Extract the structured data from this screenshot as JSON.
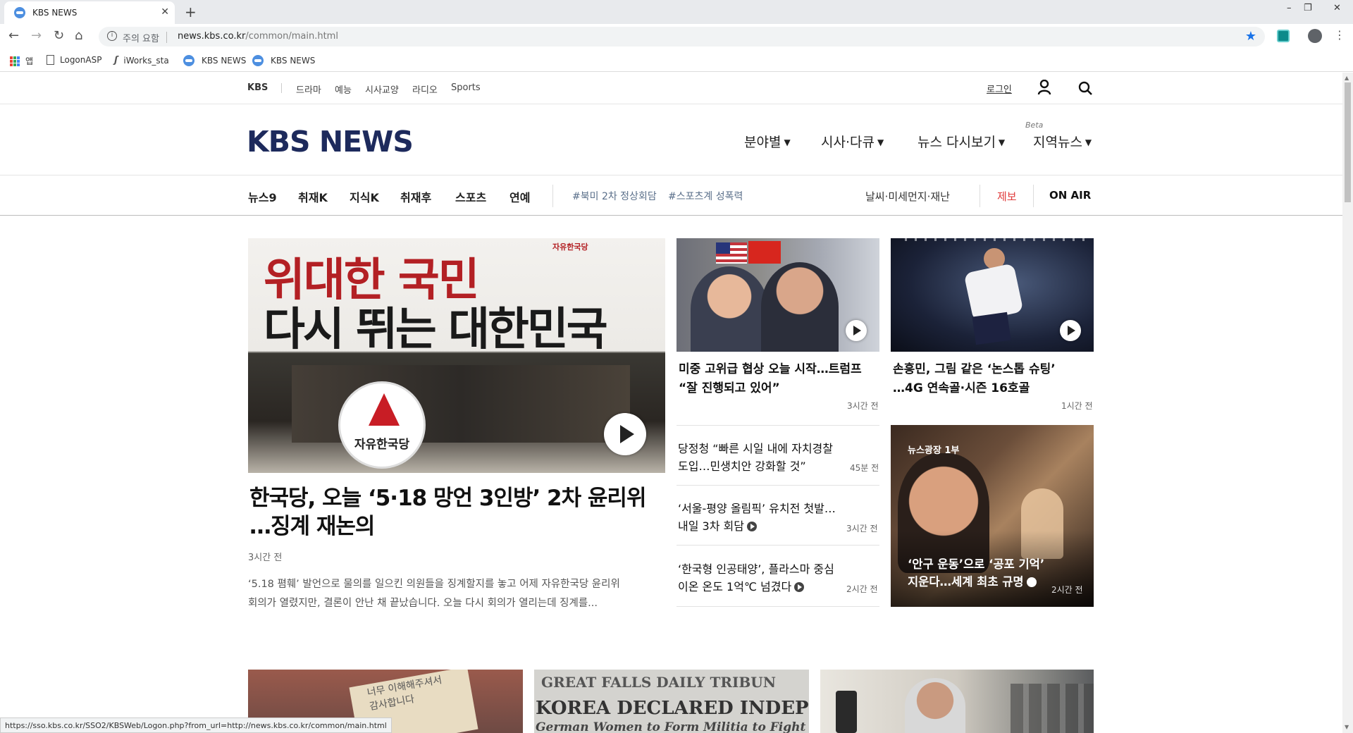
{
  "browser": {
    "tab_title": "KBS NEWS",
    "new_tab": "+",
    "window_controls": [
      "–",
      "❐",
      "✕"
    ],
    "omnibox_warning": "주의 요함",
    "url_host": "news.kbs.co.kr",
    "url_path": "/common/main.html",
    "bookmarks": [
      "앱",
      "LogonASP",
      "iWorks_sta",
      "KBS NEWS",
      "KBS NEWS"
    ],
    "status_url": "https://sso.kbs.co.kr/SSO2/KBSWeb/Logon.php?from_url=http://news.kbs.co.kr/common/main.html"
  },
  "gnb": {
    "brand": "KBS",
    "items": [
      "드라마",
      "예능",
      "시사교양",
      "라디오",
      "Sports"
    ],
    "login": "로그인"
  },
  "header": {
    "logo": "KBS NEWS",
    "menus": [
      "분야별",
      "시사·다큐",
      "뉴스 다시보기",
      "지역뉴스"
    ],
    "beta": "Beta"
  },
  "subnav": {
    "items": [
      "뉴스9",
      "취재K",
      "지식K",
      "취재후",
      "스포츠",
      "연예"
    ],
    "tags": [
      "#북미 2차 정상회담",
      "#스포츠계 성폭력"
    ],
    "right": [
      "날씨·미세먼지·재난",
      "제보",
      "ON AIR"
    ]
  },
  "main_story": {
    "image_text_line1": "위대한 국민",
    "image_text_line2": "다시 뛰는 대한민국",
    "image_party": "자유한국당",
    "image_corner": "자유한국당",
    "headline_line1": "한국당, 오늘 ‘5·18 망언 3인방’ 2차 윤리위",
    "headline_line2": "…징계 재논의",
    "time": "3시간 전",
    "summary_line1": "‘5.18 폄훼’ 발언으로 물의를 일으킨 의원들을 징계할지를 놓고 어제 자유한국당 윤리위",
    "summary_line2": "회의가 열렸지만, 결론이 안난 채 끝났습니다. 오늘 다시 회의가 열리는데 징계를..."
  },
  "story_trump": {
    "headline_line1": "미중 고위급 협상 오늘 시작…트럼프",
    "headline_line2": "“잘 진행되고 있어”",
    "time": "3시간 전"
  },
  "story_son": {
    "headline_line1": "손흥민, 그림 같은 ‘논스톱 슈팅’",
    "headline_line2": "…4G 연속골·시즌 16호골",
    "time": "1시간 전"
  },
  "list_stories": [
    {
      "line1": "당정청 “빠른 시일 내에 자치경찰",
      "line2": "도입…민생치안 강화할 것”",
      "time": "45분 전"
    },
    {
      "line1": "‘서울-평양 올림픽’ 유치전 첫발…",
      "line2": "내일 3차 회담",
      "time": "3시간 전"
    },
    {
      "line1": "‘한국형 인공태양’, 플라스마 중심",
      "line2": "이온 온도 1억℃ 넘겼다",
      "time": "2시간 전"
    }
  ],
  "feature_story": {
    "badge": "뉴스광장 1부",
    "line1": "‘안구 운동’으로 ‘공포 기억’",
    "line2": "지운다…세계 최초 규명",
    "time": "2시간 전"
  },
  "bottom_images": {
    "note_text_line1": "너무 이해해주셔서",
    "note_text_line2": "감사합니다",
    "paper_line1": "GREAT FALLS DAILY TRIBUN",
    "paper_line2": "KOREA DECLARED INDEPENDE",
    "paper_line3": "German Women to Form Militia to Fight I"
  },
  "colors": {
    "logo": "#1d2a5c",
    "jebo": "#e03a3a",
    "tag": "#5a6f8a",
    "chrome": "#e8eaed"
  }
}
